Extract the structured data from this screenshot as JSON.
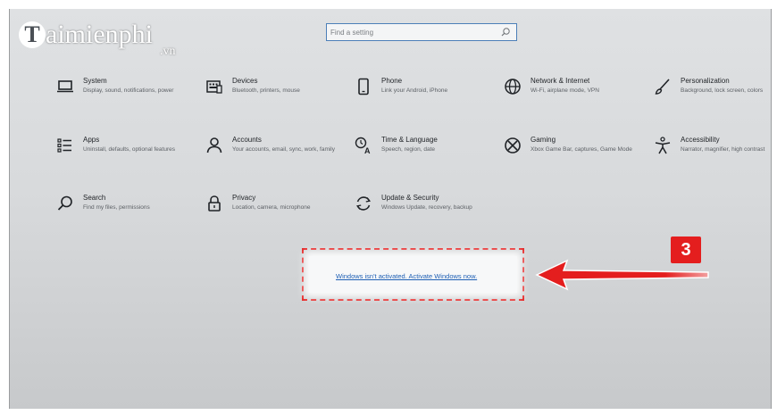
{
  "brand": {
    "initial": "T",
    "name": "aimienphi",
    "suffix": ".vn"
  },
  "search": {
    "placeholder": "Find a setting",
    "icon": "search-icon"
  },
  "settings": [
    {
      "id": "system",
      "title": "System",
      "desc": "Display, sound, notifications, power",
      "icon": "laptop-icon"
    },
    {
      "id": "devices",
      "title": "Devices",
      "desc": "Bluetooth, printers, mouse",
      "icon": "keyboard-icon"
    },
    {
      "id": "phone",
      "title": "Phone",
      "desc": "Link your Android, iPhone",
      "icon": "phone-icon"
    },
    {
      "id": "network",
      "title": "Network & Internet",
      "desc": "Wi-Fi, airplane mode, VPN",
      "icon": "globe-icon"
    },
    {
      "id": "personalization",
      "title": "Personalization",
      "desc": "Background, lock screen, colors",
      "icon": "brush-icon"
    },
    {
      "id": "apps",
      "title": "Apps",
      "desc": "Uninstall, defaults, optional features",
      "icon": "apps-list-icon"
    },
    {
      "id": "accounts",
      "title": "Accounts",
      "desc": "Your accounts, email, sync, work, family",
      "icon": "person-icon"
    },
    {
      "id": "time",
      "title": "Time & Language",
      "desc": "Speech, region, date",
      "icon": "time-language-icon"
    },
    {
      "id": "gaming",
      "title": "Gaming",
      "desc": "Xbox Game Bar, captures, Game Mode",
      "icon": "xbox-icon"
    },
    {
      "id": "accessibility",
      "title": "Accessibility",
      "desc": "Narrator, magnifier, high contrast",
      "icon": "accessibility-icon"
    },
    {
      "id": "search",
      "title": "Search",
      "desc": "Find my files, permissions",
      "icon": "magnifier-icon"
    },
    {
      "id": "privacy",
      "title": "Privacy",
      "desc": "Location, camera, microphone",
      "icon": "lock-icon"
    },
    {
      "id": "update",
      "title": "Update & Security",
      "desc": "Windows Update, recovery, backup",
      "icon": "sync-icon"
    }
  ],
  "activation": {
    "link_text": "Windows isn't activated. Activate Windows now."
  },
  "annotation": {
    "step": "3"
  },
  "colors": {
    "accent": "#1e5fb4",
    "annotation": "#e41e1e"
  }
}
